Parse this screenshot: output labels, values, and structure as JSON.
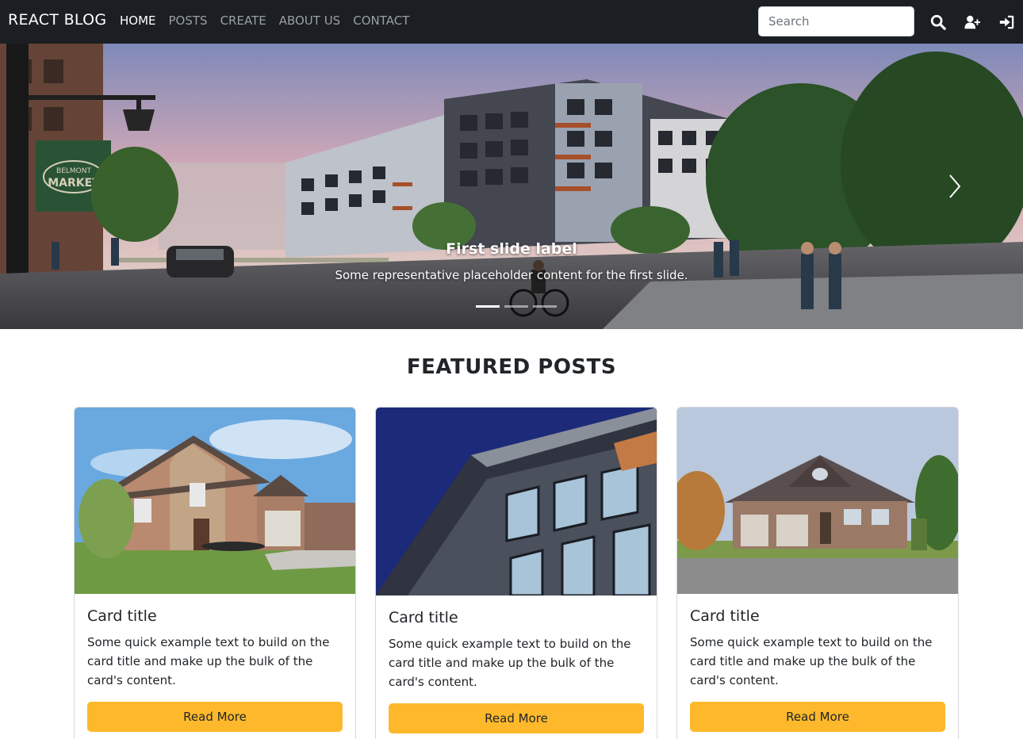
{
  "navbar": {
    "brand": "REACT BLOG",
    "links": [
      "HOME",
      "POSTS",
      "CREATE",
      "ABOUT US",
      "CONTACT"
    ],
    "active_link": "HOME",
    "search_placeholder": "Search",
    "icons": [
      "search-icon",
      "user-plus-icon",
      "sign-in-icon"
    ]
  },
  "carousel": {
    "slide_title": "First slide label",
    "slide_text": "Some representative placeholder content for the first slide.",
    "sign_text": [
      "BELMONT",
      "MARKET"
    ],
    "indicator_count": 3,
    "active_indicator": 0
  },
  "featured": {
    "heading": "FEATURED POSTS",
    "cards": [
      {
        "title": "Card title",
        "text": "Some quick example text to build on the card title and make up the bulk of the card's content.",
        "button": "Read More"
      },
      {
        "title": "Card title",
        "text": "Some quick example text to build on the card title and make up the bulk of the card's content.",
        "button": "Read More"
      },
      {
        "title": "Card title",
        "text": "Some quick example text to build on the card title and make up the bulk of the card's content.",
        "button": "Read More"
      }
    ]
  },
  "colors": {
    "navbar_bg": "#1b1e22",
    "button_accent": "#fdb92b",
    "nav_inactive": "#9aa0a6"
  }
}
